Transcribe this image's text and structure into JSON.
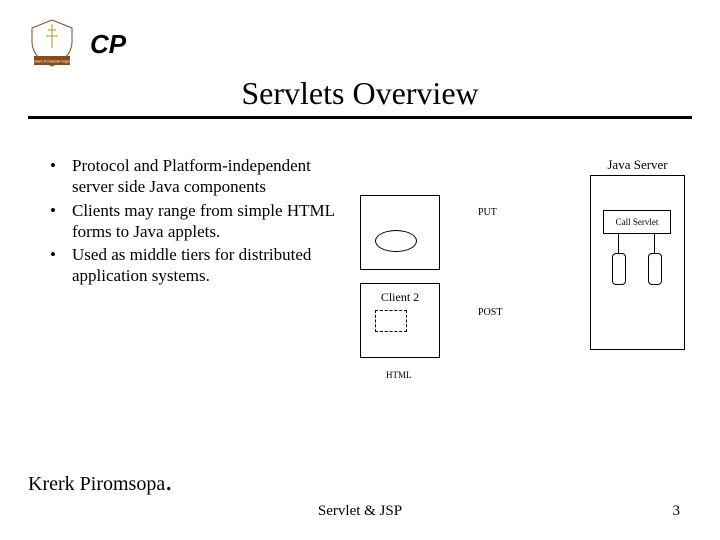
{
  "title": "Servlets Overview",
  "bullets": [
    "Protocol and Platform-independent server side Java components",
    "Clients may range from simple HTML forms to Java applets.",
    "Used as middle tiers for distributed application systems."
  ],
  "diagram": {
    "client2": "Client 2",
    "html": "HTML",
    "server": "Java Server",
    "servlet": "Call Servlet",
    "put": "PUT",
    "post": "POST"
  },
  "author": "Krerk Piromsopa",
  "footer": "Servlet & JSP",
  "page": "3",
  "logo2": "CP"
}
